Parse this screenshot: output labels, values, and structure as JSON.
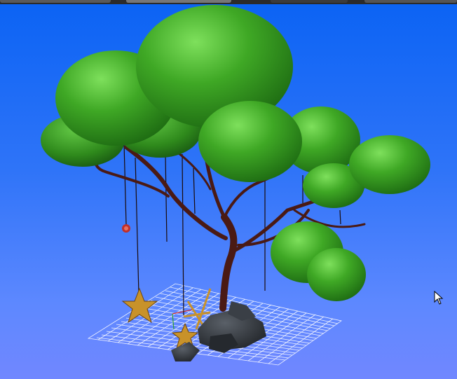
{
  "viewport": {
    "background_top": "#0b63f4",
    "background_bottom": "#7187ff"
  },
  "scene": {
    "object": "tree-with-hanging-ornaments",
    "grid_color": "#ffffff",
    "foliage_color": "#3fa825",
    "trunk_color": "#4a1a14",
    "ornament_star_color": "#c8922a",
    "ornament_ball_color": "#c0302a",
    "rock_color": "#2e3238"
  },
  "cursor": {
    "icon": "mouse-pointer-icon"
  }
}
